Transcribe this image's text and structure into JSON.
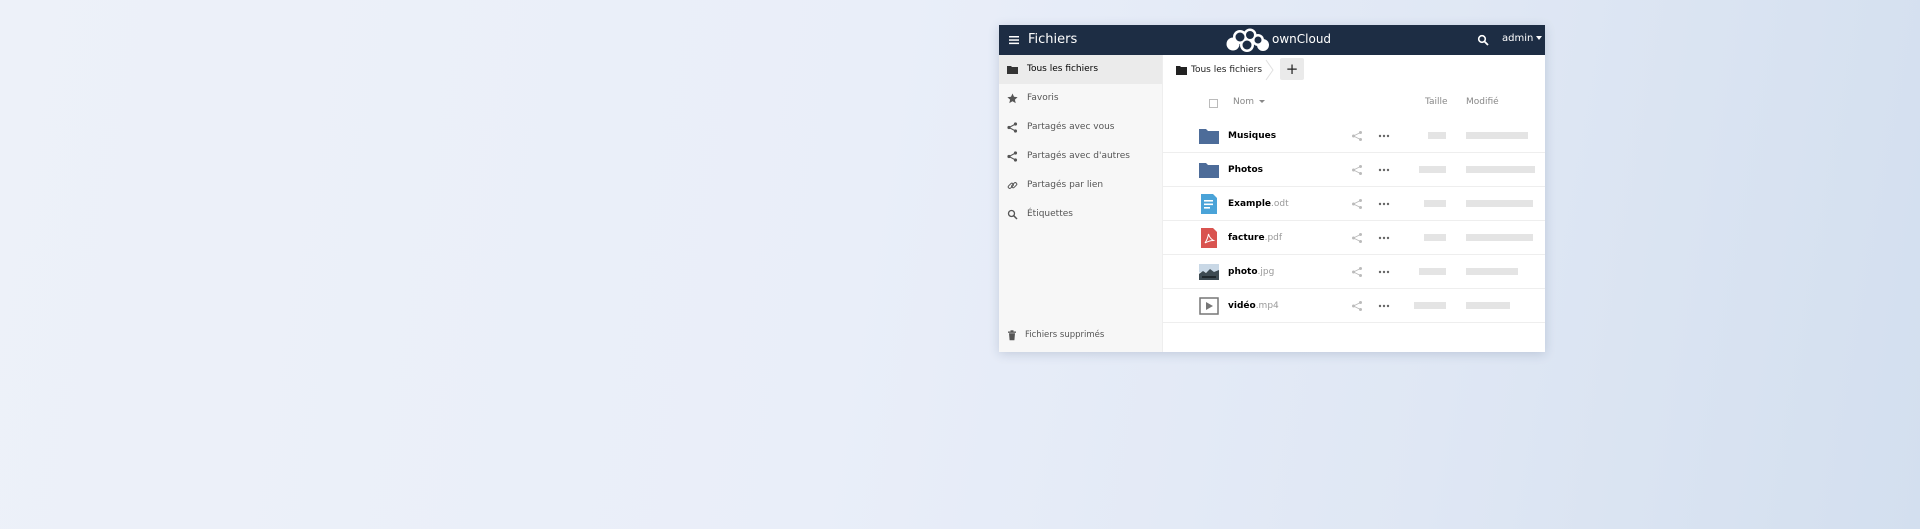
{
  "app": {
    "title": "Fichiers",
    "brand": "ownCloud",
    "user": "admin"
  },
  "sidebar": {
    "items": [
      {
        "label": "Tous les fichiers",
        "icon": "folder-icon",
        "active": true
      },
      {
        "label": "Favoris",
        "icon": "star-icon"
      },
      {
        "label": "Partagés avec vous",
        "icon": "share-icon"
      },
      {
        "label": "Partagés avec d'autres",
        "icon": "share-icon"
      },
      {
        "label": "Partagés par lien",
        "icon": "link-icon"
      },
      {
        "label": "Étiquettes",
        "icon": "search-icon"
      }
    ],
    "trash_label": "Fichiers supprimés"
  },
  "breadcrumb": {
    "root": "Tous les fichiers"
  },
  "toolbar": {
    "new_label": "+"
  },
  "table": {
    "columns": {
      "name": "Nom",
      "size": "Taille",
      "modified": "Modifié"
    },
    "rows": [
      {
        "name": "Musiques",
        "ext": "",
        "type": "folder"
      },
      {
        "name": "Photos",
        "ext": "",
        "type": "folder"
      },
      {
        "name": "Example",
        "ext": ".odt",
        "type": "document"
      },
      {
        "name": "facture",
        "ext": ".pdf",
        "type": "pdf"
      },
      {
        "name": "photo",
        "ext": ".jpg",
        "type": "image"
      },
      {
        "name": "vidéo",
        "ext": ".mp4",
        "type": "video"
      }
    ]
  },
  "colors": {
    "header_bg": "#1d2d44",
    "folder": "#4d6c99",
    "document": "#4aa3d8",
    "pdf": "#d9534f"
  }
}
